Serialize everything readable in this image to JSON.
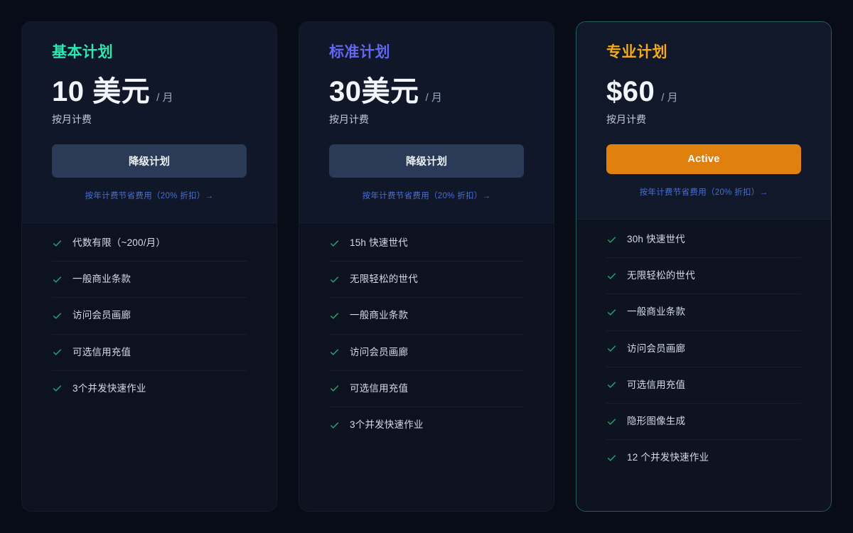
{
  "colors": {
    "page_background": "#080c16",
    "card_background": "#0d1220",
    "featured_border": "#1f5f5d",
    "secondary_button": "#2b3a56",
    "primary_button": "#e0810f",
    "link": "#4a6fd4",
    "check": "#25a36f"
  },
  "plans": [
    {
      "title": "基本计划",
      "title_color": "#2ee6b0",
      "price_amount": "10 美元",
      "price_period": "/ 月",
      "billing_note": "按月计费",
      "action_label": "降级计划",
      "action_style": "secondary",
      "annual_link": "按年计费节省费用（20% 折扣）→",
      "featured": false,
      "features": [
        "代数有限（~200/月）",
        "一般商业条款",
        "访问会员画廊",
        "可选信用充值",
        "3个并发快速作业"
      ]
    },
    {
      "title": "标准计划",
      "title_color": "#6366f1",
      "price_amount": "30美元",
      "price_period": "/ 月",
      "billing_note": "按月计费",
      "action_label": "降级计划",
      "action_style": "secondary",
      "annual_link": "按年计费节省费用（20% 折扣）→",
      "featured": false,
      "features": [
        "15h 快速世代",
        "无限轻松的世代",
        "一般商业条款",
        "访问会员画廊",
        "可选信用充值",
        "3个并发快速作业"
      ]
    },
    {
      "title": "专业计划",
      "title_color": "#f2ab16",
      "price_amount": "$60",
      "price_period": "/ 月",
      "billing_note": "按月计费",
      "action_label": "Active",
      "action_style": "primary",
      "annual_link": "按年计费节省费用（20% 折扣）→",
      "featured": true,
      "features": [
        "30h 快速世代",
        "无限轻松的世代",
        "一般商业条款",
        "访问会员画廊",
        "可选信用充值",
        "隐形图像生成",
        "12 个并发快速作业"
      ]
    }
  ],
  "icons": {
    "check": "check-icon",
    "arrow": "arrow-right-icon"
  }
}
